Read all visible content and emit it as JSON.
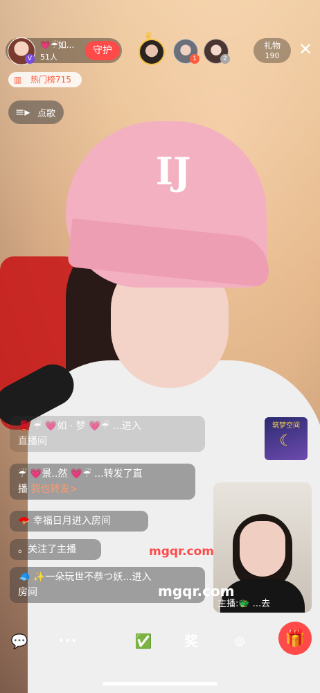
{
  "host": {
    "name": "💗☔如...",
    "viewers": "51人",
    "follow_label": "守护",
    "badge": "V"
  },
  "ranks": [
    {
      "badge": "1"
    },
    {
      "badge": "2"
    }
  ],
  "gifts": {
    "label": "礼物",
    "count": "190"
  },
  "hot": {
    "icon": "▥",
    "label": "热门榜715"
  },
  "song": {
    "icon": "≡▸",
    "label": "点歌"
  },
  "chat": [
    {
      "line1": "🥊 ☔ 💗如 · 梦 💗☔ ...进入",
      "line2": "直播间"
    },
    {
      "line1": "☔ 💗景..然 💗☔ ...转发了直",
      "line2_a": "播 ",
      "line2_b": "我也转发>"
    },
    {
      "text": "🪭 幸福日月进入房间"
    },
    {
      "text": "。关注了主播"
    },
    {
      "line1": "🧢 ✨一朵玩世不恭つ妖...进入",
      "line2": "房间"
    }
  ],
  "promo": {
    "title": "筑梦空间"
  },
  "pip": {
    "caption": "主播:🐲 ...去"
  },
  "watermarks": [
    "mgqr.com",
    "mgqr.com"
  ],
  "icons": {
    "close": "✕",
    "chat": "💬",
    "more": "•••",
    "task": "✅",
    "prize": "奖",
    "camera": "⊚",
    "gift": "🎁",
    "crown": "♛",
    "moon": "☾"
  }
}
